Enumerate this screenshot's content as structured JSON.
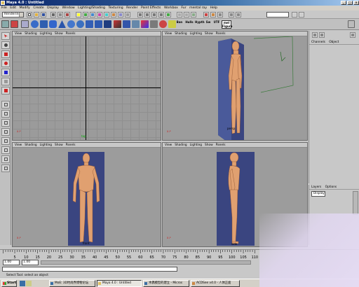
{
  "window": {
    "title": "Maya 4.0 : Untitled"
  },
  "menubar": [
    "File",
    "Edit",
    "Modify",
    "Create",
    "Display",
    "Window",
    "Lighting/Shading",
    "Texturing",
    "Render",
    "Paint Effects",
    "Workbox",
    "Fur",
    "mental ray",
    "Help"
  ],
  "status": {
    "mode": "Rendering"
  },
  "shelf": {
    "labels": [
      "Ban",
      "Hulls",
      "Hypth",
      "Sw",
      "UTF",
      "mel Figure"
    ]
  },
  "viewports": {
    "menu": [
      "View",
      "Shading",
      "Lighting",
      "Show",
      "Panels"
    ],
    "top_left": {
      "camera": "top"
    },
    "top_right": {
      "camera": "persp"
    },
    "bottom_left": {
      "camera": "front"
    },
    "bottom_right": {
      "camera": "side"
    }
  },
  "channelbox": {
    "menu": [
      "Channels",
      "Object"
    ]
  },
  "layers": {
    "menu": [
      "Layers",
      "Options"
    ],
    "selected": "Display"
  },
  "timeline": {
    "ticks": [
      "5",
      "10",
      "15",
      "20",
      "25",
      "30",
      "35",
      "40",
      "45",
      "50",
      "55",
      "60",
      "65",
      "70",
      "75",
      "80",
      "85",
      "90",
      "95",
      "100",
      "105",
      "110"
    ]
  },
  "range": {
    "start": "1.00",
    "end": "1.00"
  },
  "helpline": "Select Tool: select an object",
  "taskbar": {
    "start": "Start",
    "tasks": [
      "MoE: 3D时尚界博物论坛",
      "Maya 4.0 : Untitled",
      "木偶模型的建立 - Micros",
      "ACDSee v4.0 - 人体正面"
    ]
  }
}
